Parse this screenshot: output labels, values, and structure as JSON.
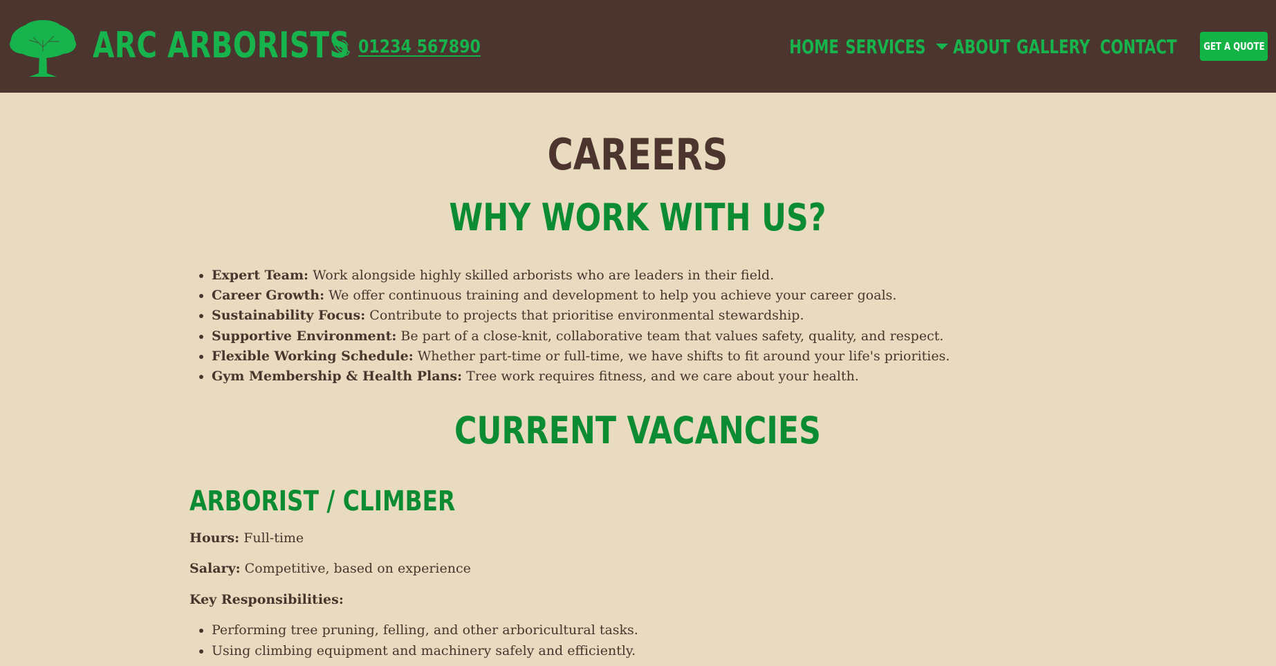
{
  "header": {
    "brand_name": "ARC ARBORISTS",
    "phone": "01234 567890",
    "nav": {
      "home": "HOME",
      "services": "SERVICES",
      "about": "ABOUT",
      "gallery": "GALLERY",
      "contact": "CONTACT"
    },
    "quote_button": "GET A QUOTE",
    "colors": {
      "header_bg": "#4b352e",
      "accent_green": "#17b34c",
      "button_green": "#13b346"
    }
  },
  "main": {
    "title": "CAREERS",
    "why_title": "WHY WORK WITH US?",
    "benefits": [
      {
        "label": "Expert Team:",
        "text": " Work alongside highly skilled arborists who are leaders in their field."
      },
      {
        "label": "Career Growth:",
        "text": " We offer continuous training and development to help you achieve your career goals."
      },
      {
        "label": "Sustainability Focus:",
        "text": " Contribute to projects that prioritise environmental stewardship."
      },
      {
        "label": "Supportive Environment:",
        "text": " Be part of a close-knit, collaborative team that values safety, quality, and respect."
      },
      {
        "label": "Flexible Working Schedule:",
        "text": " Whether part-time or full-time, we have shifts to fit around your life's priorities."
      },
      {
        "label": "Gym Membership & Health Plans:",
        "text": " Tree work requires fitness, and we care about your health."
      }
    ],
    "vacancies_title": "CURRENT VACANCIES",
    "job": {
      "title": "ARBORIST / CLIMBER",
      "hours_label": "Hours:",
      "hours_value": " Full-time",
      "salary_label": "Salary:",
      "salary_value": " Competitive, based on experience",
      "responsibilities_label": "Key Responsibilities:",
      "responsibilities": [
        "Performing tree pruning, felling, and other arboricultural tasks.",
        "Using climbing equipment and machinery safely and efficiently."
      ]
    },
    "colors": {
      "page_bg": "#e9dbc0",
      "heading_brown": "#4b352e",
      "heading_green": "#0b8c33"
    }
  }
}
